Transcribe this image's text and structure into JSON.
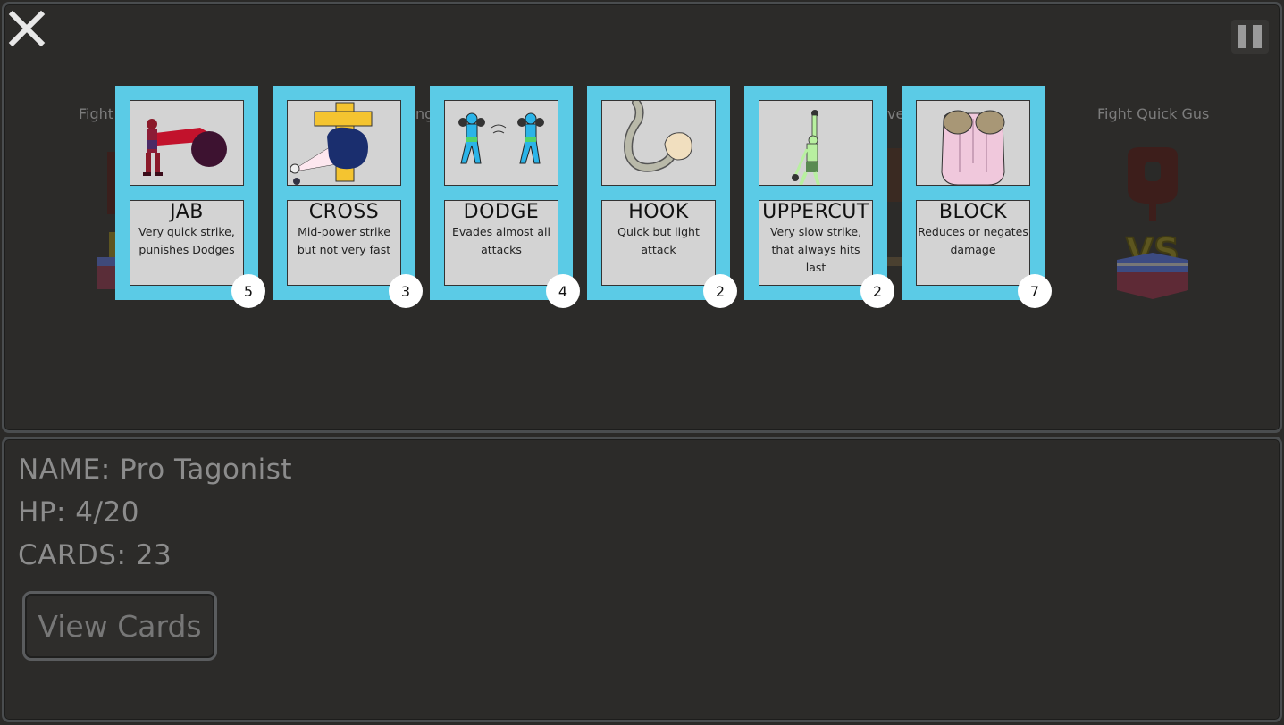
{
  "background_fights": {
    "left_label": "Fight",
    "mid_left_fragment": "ng",
    "mid_right_fragment": "ve",
    "right_label": "Fight Quick Gus",
    "vs_text": "VS"
  },
  "cards": [
    {
      "title": "JAB",
      "description": "Very quick strike, punishes Dodges",
      "count": "5"
    },
    {
      "title": "CROSS",
      "description": "Mid-power strike but not very fast",
      "count": "3"
    },
    {
      "title": "DODGE",
      "description": "Evades almost all attacks",
      "count": "4"
    },
    {
      "title": "HOOK",
      "description": "Quick but light attack",
      "count": "2"
    },
    {
      "title": "UPPERCUT",
      "description": "Very slow strike, that always hits last",
      "count": "2"
    },
    {
      "title": "BLOCK",
      "description": "Reduces or negates damage",
      "count": "7"
    }
  ],
  "player": {
    "name_line": "NAME: Pro Tagonist",
    "hp_line": "HP: 4/20",
    "cards_line": "CARDS: 23"
  },
  "view_cards_label": "View Cards",
  "colors": {
    "card_frame": "#5bcbe6",
    "card_face": "#d3d3d3",
    "background": "#2b2a28"
  }
}
